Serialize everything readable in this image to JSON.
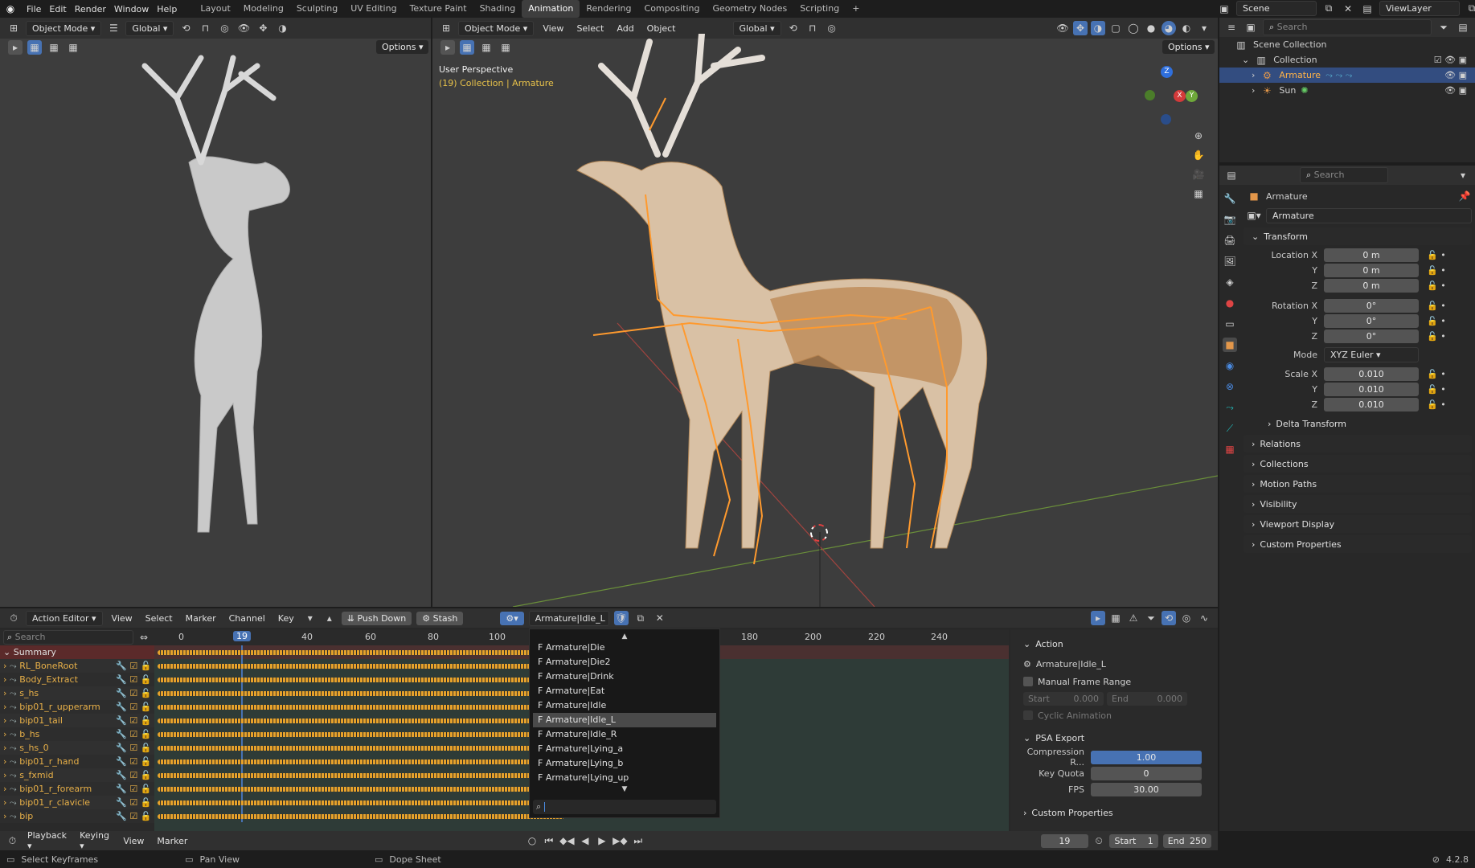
{
  "topbar": {
    "menus": [
      "File",
      "Edit",
      "Render",
      "Window",
      "Help"
    ],
    "workspaces": [
      "Layout",
      "Modeling",
      "Sculpting",
      "UV Editing",
      "Texture Paint",
      "Shading",
      "Animation",
      "Rendering",
      "Compositing",
      "Geometry Nodes",
      "Scripting"
    ],
    "active_workspace": "Animation",
    "scene": "Scene",
    "view_layer": "ViewLayer"
  },
  "left_viewport": {
    "mode": "Object Mode",
    "orientation": "Global",
    "options": "Options"
  },
  "main_viewport": {
    "mode": "Object Mode",
    "menus": [
      "View",
      "Select",
      "Add",
      "Object"
    ],
    "orientation": "Global",
    "options": "Options",
    "perspective": "User Perspective",
    "context": "(19) Collection | Armature",
    "gizmo_axes": [
      "Z",
      "Y",
      "X"
    ]
  },
  "outliner": {
    "search": "Search",
    "items": [
      "Scene Collection",
      "Collection",
      "Armature",
      "Sun"
    ]
  },
  "properties": {
    "search": "Search",
    "object_name": "Armature",
    "data_name": "Armature",
    "transform_title": "Transform",
    "location": {
      "label": "Location X",
      "x": "0 m",
      "y": "0 m",
      "z": "0 m"
    },
    "rotation": {
      "label": "Rotation X",
      "x": "0°",
      "y": "0°",
      "z": "0°"
    },
    "mode_label": "Mode",
    "mode_value": "XYZ Euler",
    "scale": {
      "label": "Scale X",
      "x": "0.010",
      "y": "0.010",
      "z": "0.010"
    },
    "axis_labels": [
      "Y",
      "Z"
    ],
    "sections": [
      "Delta Transform",
      "Relations",
      "Collections",
      "Motion Paths",
      "Visibility",
      "Viewport Display",
      "Custom Properties"
    ]
  },
  "action_editor": {
    "editor": "Action Editor",
    "menus": [
      "View",
      "Select",
      "Marker",
      "Channel",
      "Key"
    ],
    "push_down": "Push Down",
    "stash": "Stash",
    "action": "Armature|Idle_L",
    "search": "Search",
    "frames": [
      "0",
      "40",
      "60",
      "80",
      "100",
      "180",
      "200",
      "220",
      "240"
    ],
    "current_frame": "19",
    "summary": "Summary",
    "channels": [
      "RL_BoneRoot",
      "Body_Extract",
      "s_hs",
      "bip01_r_upperarm",
      "bip01_tail",
      "b_hs",
      "s_hs_0",
      "bip01_r_hand",
      "s_fxmid",
      "bip01_r_forearm",
      "bip01_r_clavicle",
      "bip"
    ]
  },
  "dropdown": {
    "items": [
      "Armature|Die",
      "Armature|Die2",
      "Armature|Drink",
      "Armature|Eat",
      "Armature|Idle",
      "Armature|Idle_L",
      "Armature|Idle_R",
      "Armature|Lying_a",
      "Armature|Lying_b",
      "Armature|Lying_up"
    ],
    "prefix": "F"
  },
  "action_panel": {
    "title": "Action",
    "action_name": "Armature|Idle_L",
    "manual_frame_range": "Manual Frame Range",
    "start_label": "Start",
    "start_value": "0.000",
    "end_label": "End",
    "end_value": "0.000",
    "cyclic": "Cyclic Animation",
    "psa_title": "PSA Export",
    "compression_label": "Compression R...",
    "compression_value": "1.00",
    "compression_fill": 1.0,
    "key_quota_label": "Key Quota",
    "key_quota_value": "0",
    "fps_label": "FPS",
    "fps_value": "30.00",
    "custom_props": "Custom Properties"
  },
  "timeline": {
    "menus": [
      "Playback",
      "Keying",
      "View",
      "Marker"
    ],
    "frame": "19",
    "start_label": "Start",
    "start": "1",
    "end_label": "End",
    "end": "250"
  },
  "statusbar": {
    "left": "Select Keyframes",
    "middle": "Pan View",
    "right": "Dope Sheet",
    "version": "4.2.8"
  }
}
